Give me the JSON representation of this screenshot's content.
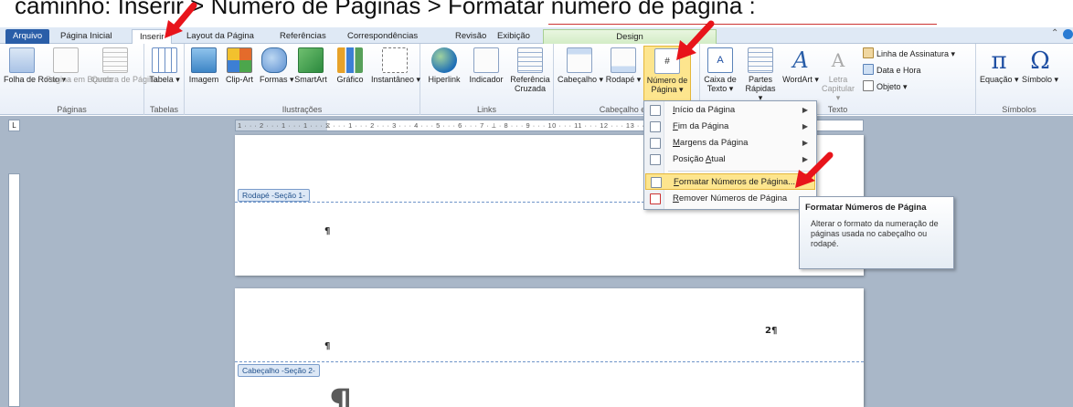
{
  "caption": {
    "text": "caminho: Inserir > Número de Páginas > Formatar número de página :"
  },
  "tabs": [
    {
      "label": "Arquivo"
    },
    {
      "label": "Página Inicial"
    },
    {
      "label": "Inserir"
    },
    {
      "label": "Layout da Página"
    },
    {
      "label": "Referências"
    },
    {
      "label": "Correspondências"
    },
    {
      "label": "Revisão"
    },
    {
      "label": "Exibição"
    },
    {
      "label": "Design"
    }
  ],
  "ribbon": {
    "groups": {
      "paginas": {
        "label": "Páginas",
        "buttons": [
          "Folha de Rosto ▾",
          "Página em Branco",
          "Quebra de Página"
        ]
      },
      "tabelas": {
        "label": "Tabelas",
        "buttons": [
          "Tabela ▾"
        ]
      },
      "ilustracoes": {
        "label": "Ilustrações",
        "buttons": [
          "Imagem",
          "Clip-Art",
          "Formas ▾",
          "SmartArt",
          "Gráfico",
          "Instantâneo ▾"
        ]
      },
      "links": {
        "label": "Links",
        "buttons": [
          "Hiperlink",
          "Indicador",
          "Referência Cruzada"
        ]
      },
      "cabecalho": {
        "label": "Cabeçalho e R",
        "buttons": [
          "Cabeçalho ▾",
          "Rodapé ▾",
          "Número de Página ▾"
        ]
      },
      "texto": {
        "label": "Texto",
        "buttons": [
          "Caixa de Texto ▾",
          "Partes Rápidas ▾",
          "WordArt ▾",
          "Letra Capitular ▾"
        ],
        "small": [
          "Linha de Assinatura ▾",
          "Data e Hora",
          "Objeto ▾"
        ]
      },
      "simbolos": {
        "label": "Símbolos",
        "buttons": [
          "Equação ▾",
          "Símbolo ▾"
        ],
        "glyphs": [
          "π",
          "Ω"
        ]
      }
    }
  },
  "ruler": {
    "top": "1 · · · 2 · · · 1 · · · 1 · · · ⧖ · · · 1 · · · 2 · · · 3 · · · 4 · · · 5 · · · 6 · · · 7 · ⊥ · 8 · · · 9 · · · 10 · · · 11 · · · 12 · · · 13 · · · 14 · · · 15 · · · 16 · · · 17 · · ·",
    "corner": "L"
  },
  "document": {
    "footer_tag": "Rodapé -Seção 1-",
    "header_tag": "Cabeçalho -Seção 2-",
    "pilcrow": "¶",
    "page_number_mark": "2¶"
  },
  "dropdown": {
    "items": [
      {
        "label": "Início da Página",
        "accel": "I",
        "rest": "nício da Página",
        "submenu": true
      },
      {
        "label": "Fim da Página",
        "accel": "F",
        "rest": "im da Página",
        "submenu": true
      },
      {
        "label": "Margens da Página",
        "accel": "M",
        "rest": "argens da Página",
        "submenu": true
      },
      {
        "label": "Posição Atual",
        "accel": "A",
        "rest": "tual",
        "prefix": "Posição ",
        "submenu": true
      },
      {
        "label": "Formatar Números de Página...",
        "accel": "F",
        "rest": "ormatar Números de Página...",
        "submenu": false
      },
      {
        "label": "Remover Números de Página",
        "accel": "R",
        "rest": "emover Números de Página",
        "submenu": false
      }
    ]
  },
  "tooltip": {
    "title": "Formatar Números de Página",
    "body": "Alterar o formato da numeração de páginas usada no cabeçalho ou rodapé."
  },
  "colors": {
    "accent": "#2a5ea8",
    "highlight": "#fde58e",
    "arrow": "#e8141b"
  }
}
